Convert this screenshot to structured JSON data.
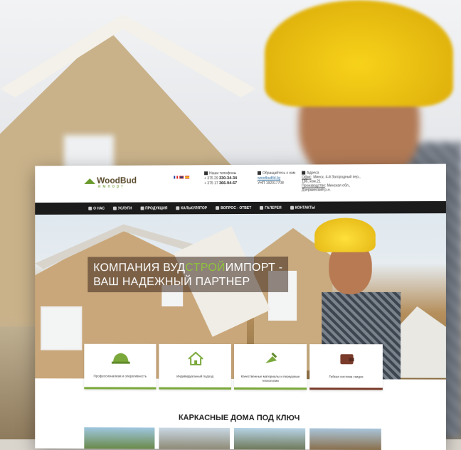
{
  "logo": {
    "brand": "WoodBud",
    "sub": "импорт"
  },
  "languages": [
    "fr",
    "en",
    "es"
  ],
  "contacts": {
    "phones_title": "Наши телефоны",
    "phone1_prefix": "+ 375 29",
    "phone1": "330-34-34",
    "phone2_prefix": "+ 375 17",
    "phone2": "366-94-67",
    "email_title": "Обращайтесь к нам",
    "email": "woodbudltd.by",
    "unp": "УНП 192017708"
  },
  "address": {
    "title": "Адреса",
    "office_label": "Офис",
    "office": ": Минск, 4-й Загородный пер., 186, ком.21",
    "production_label": "Производство",
    "production": ": Минская обл., Дзержинский р-н."
  },
  "nav": [
    "О НАС",
    "УСЛУГИ",
    "ПРОДУКЦИЯ",
    "КАЛЬКУЛЯТОР",
    "ВОПРОС - ОТВЕТ",
    "ГАЛЕРЕЯ",
    "КОНТАКТЫ"
  ],
  "hero": {
    "line1_a": "КОМПАНИЯ ВУД",
    "line1_b": "СТРОЙ",
    "line1_c": "ИМПОРТ -",
    "line2": "ВАШ НАДЕЖНЫЙ ПАРТНЕР"
  },
  "features": [
    {
      "icon": "helmet-icon",
      "text": "Профессионализм и оперативность",
      "color": "#7aa83a"
    },
    {
      "icon": "blueprint-house-icon",
      "text": "Индивидуальный подход",
      "color": "#7aa83a"
    },
    {
      "icon": "trowel-icon",
      "text": "Качественные материалы и передовые технологии",
      "color": "#7aa83a"
    },
    {
      "icon": "wallet-icon",
      "text": "Гибкая система скидок",
      "color": "#7a3b2a"
    }
  ],
  "section_title": "КАРКАСНЫЕ ДОМА ПОД КЛЮЧ",
  "colors": {
    "accent": "#8fc33a",
    "nav_bg": "#1b1b1b",
    "brown": "#7a3b2a"
  }
}
